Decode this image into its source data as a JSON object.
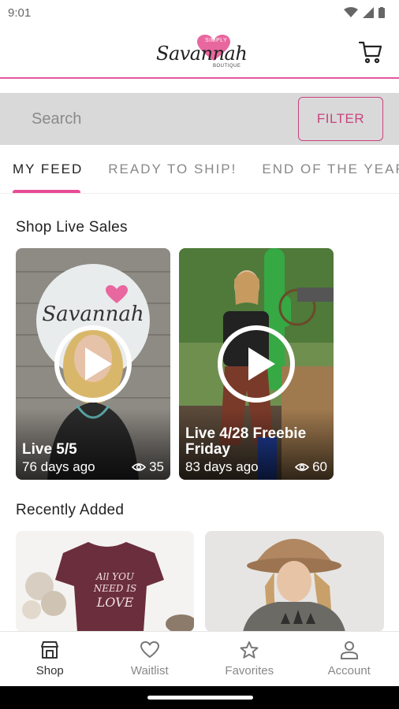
{
  "status_bar": {
    "time": "9:01"
  },
  "header": {
    "logo": {
      "script": "Savannah",
      "top": "SIMPLY",
      "bottom": "BOUTIQUE"
    },
    "brand_color": "#e4579d"
  },
  "search": {
    "placeholder": "Search",
    "filter_label": "FILTER"
  },
  "tabs": [
    {
      "label": "MY FEED"
    },
    {
      "label": "READY TO SHIP!"
    },
    {
      "label": "END OF THE YEAR"
    }
  ],
  "sections": {
    "live_sales": "Shop Live Sales",
    "recently_added": "Recently Added"
  },
  "live_sales": [
    {
      "title": "Live 5/5",
      "ago": "76 days ago",
      "views": "35"
    },
    {
      "title": "Live 4/28 Freebie Friday",
      "ago": "83 days ago",
      "views": "60"
    }
  ],
  "recent_products": [
    {
      "shirt_text": "ALL YOU NEED IS LOVE"
    },
    {
      "icon": "tree-graphic-tee"
    }
  ],
  "bottom_nav": [
    {
      "label": "Shop",
      "icon": "shop-icon"
    },
    {
      "label": "Waitlist",
      "icon": "heart-icon"
    },
    {
      "label": "Favorites",
      "icon": "star-icon"
    },
    {
      "label": "Account",
      "icon": "person-icon"
    }
  ]
}
